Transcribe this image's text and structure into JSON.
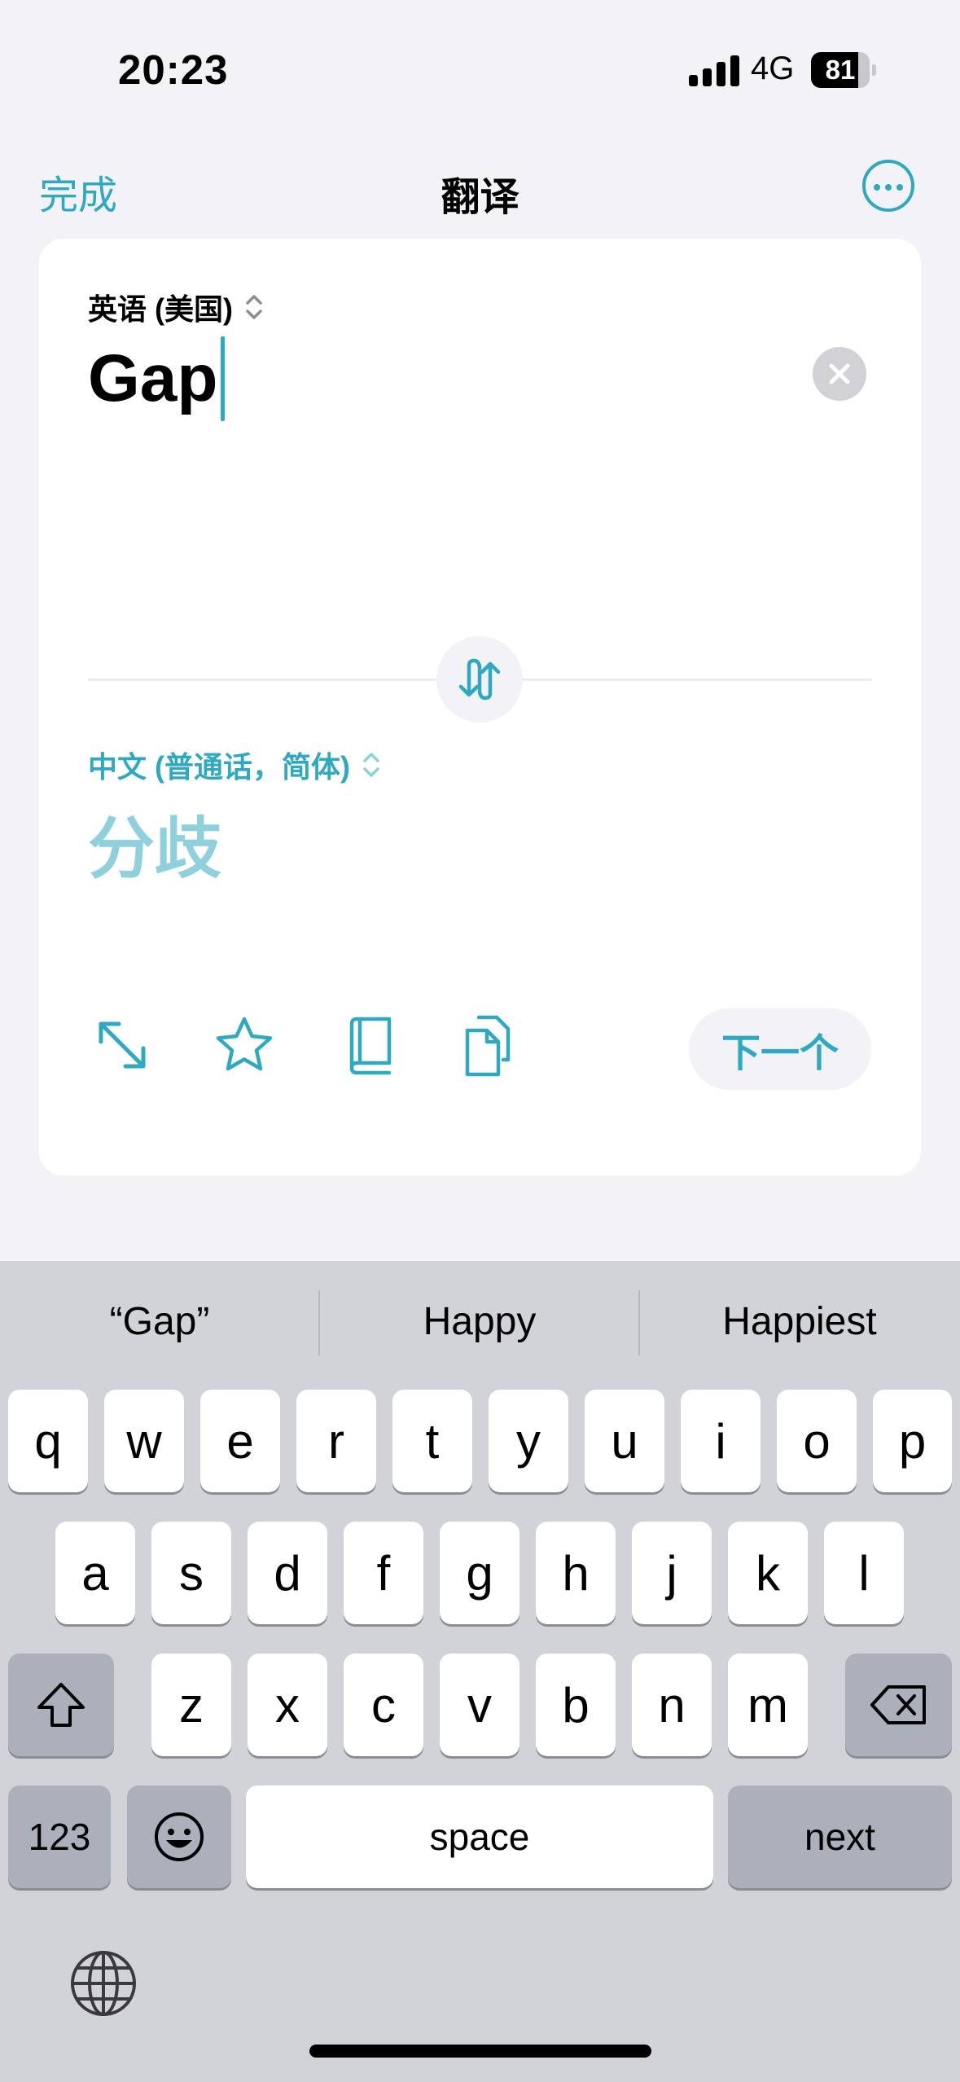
{
  "status_bar": {
    "time": "20:23",
    "network": "4G",
    "battery_level": "81",
    "battery_fraction": 0.81,
    "signal_bars": 4
  },
  "nav": {
    "done_label": "完成",
    "title": "翻译",
    "more_icon": "ellipsis-circle-icon"
  },
  "translator": {
    "source_language": "英语 (美国)",
    "source_text": "Gap",
    "target_language": "中文 (普通话，简体)",
    "target_text": "分歧",
    "next_label": "下一个",
    "tools": [
      "expand-icon",
      "star-icon",
      "book-icon",
      "copy-icon"
    ]
  },
  "keyboard": {
    "suggestions": [
      "“Gap”",
      "Happy",
      "Happiest"
    ],
    "row1": [
      "q",
      "w",
      "e",
      "r",
      "t",
      "y",
      "u",
      "i",
      "o",
      "p"
    ],
    "row2": [
      "a",
      "s",
      "d",
      "f",
      "g",
      "h",
      "j",
      "k",
      "l"
    ],
    "row3": [
      "z",
      "x",
      "c",
      "v",
      "b",
      "n",
      "m"
    ],
    "numbers_label": "123",
    "space_label": "space",
    "return_label": "next"
  },
  "colors": {
    "accent": "#2ea9c1",
    "accent_light": "#8fd0dd",
    "background": "#f2f2f7",
    "keyboard_bg": "#d1d3d9"
  }
}
